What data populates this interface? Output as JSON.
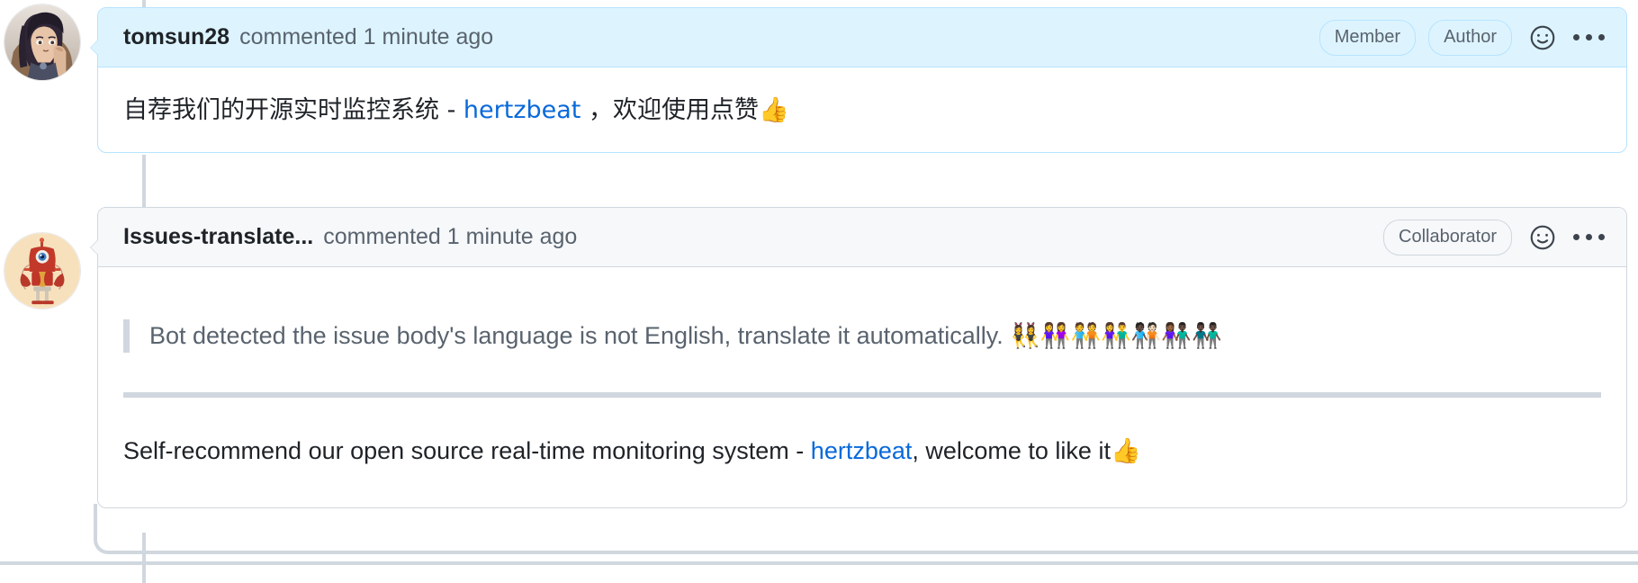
{
  "thread": {
    "comments": [
      {
        "id": "comment-tomsun28",
        "author": "tomsun28",
        "meta": "commented 1 minute ago",
        "avatar_name": "avatar-tomsun28",
        "avatar_alt": "anime character avatar",
        "highlighted": true,
        "badges": [
          "Member",
          "Author"
        ],
        "reaction_icon": "smiley-icon",
        "menu_icon": "kebab-menu-icon",
        "body": {
          "text_before_link": "自荐我们的开源实时监控系统 - ",
          "link_text": "hertzbeat",
          "text_after_link": " ，欢迎使用点赞",
          "emoji": "👍"
        }
      },
      {
        "id": "comment-issues-translate-bot",
        "author": "Issues-translate...",
        "meta": "commented 1 minute ago",
        "avatar_name": "avatar-issues-translate-bot",
        "avatar_alt": "red robot avatar",
        "highlighted": false,
        "badges": [
          "Collaborator"
        ],
        "reaction_icon": "smiley-icon",
        "menu_icon": "kebab-menu-icon",
        "body": {
          "quote_text": "Bot detected the issue body's language is not English, translate it automatically.",
          "quote_emoji": "👯‍♀️👭🧑‍🤝‍🧑👫🧑🏿‍🤝‍🧑🏻👩🏾‍🤝‍👨🏿👬🏿",
          "text_before_link": "Self-recommend our open source real-time monitoring system - ",
          "link_text": "hertzbeat",
          "text_after_link": ", welcome to like it",
          "emoji": "👍"
        }
      }
    ]
  },
  "colors": {
    "highlight_background": "#ddf4ff",
    "highlight_border": "#b6e3ff",
    "header_background": "#f6f8fa",
    "border": "#d0d7de",
    "link": "#0969da",
    "muted_text": "#59636e",
    "text": "#1f2328"
  }
}
